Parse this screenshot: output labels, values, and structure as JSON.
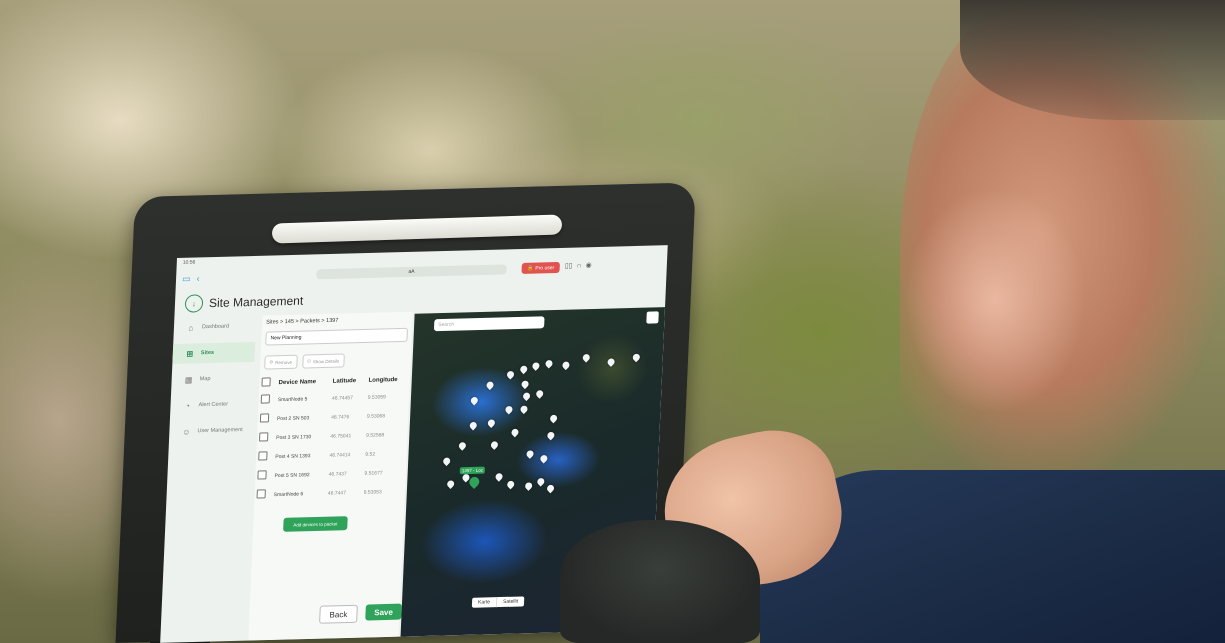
{
  "browser": {
    "time": "10:56",
    "url": "aA",
    "unlock_label": "Pro user"
  },
  "app": {
    "title": "Site Management"
  },
  "sidebar": {
    "items": [
      {
        "label": "Dashboard",
        "icon": "home-icon"
      },
      {
        "label": "Sites",
        "icon": "sites-icon",
        "active": true
      },
      {
        "label": "Map",
        "icon": "map-icon"
      },
      {
        "label": "Alert Center",
        "icon": "bell-icon"
      },
      {
        "label": "User Management",
        "icon": "users-icon"
      }
    ]
  },
  "panel": {
    "breadcrumb": "Sites > 145 > Packets > 1397",
    "selected_site": "New Planning",
    "chips": [
      "Remove",
      "Show Details"
    ],
    "columns": [
      "Device Name",
      "Latitude",
      "Longitude"
    ],
    "rows": [
      {
        "name": "SmartNode 5",
        "lat": "46.74457",
        "lon": "9.53059"
      },
      {
        "name": "Post 2 SN 503",
        "lat": "46.7476",
        "lon": "9.53068"
      },
      {
        "name": "Post 3 SN 1730",
        "lat": "46.75041",
        "lon": "9.52588"
      },
      {
        "name": "Post 4 SN 1393",
        "lat": "46.74414",
        "lon": "9.52"
      },
      {
        "name": "Post 5 SN 1692",
        "lat": "46.7437",
        "lon": "9.51677"
      },
      {
        "name": "SmartNode 6",
        "lat": "46.7447",
        "lon": "9.53053"
      }
    ],
    "add_button": "Add devices to packet",
    "back_button": "Back",
    "save_button": "Save"
  },
  "map": {
    "search_placeholder": "Search",
    "cluster_label": "1397 - Loc",
    "tabs": [
      "Karte",
      "Satellit"
    ]
  },
  "colors": {
    "accent": "#2fa35a",
    "danger": "#e0534f",
    "map_water": "#2a6fd1"
  }
}
